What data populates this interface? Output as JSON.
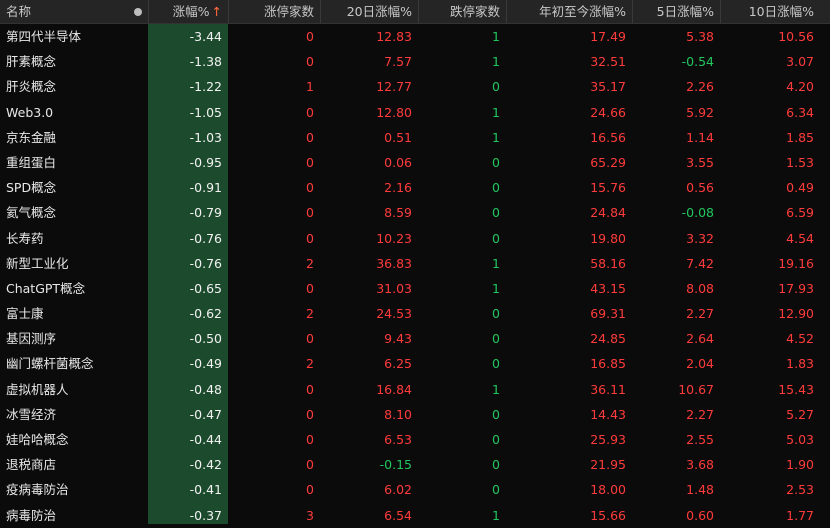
{
  "header": {
    "name": "名称",
    "change_pct": "涨幅%",
    "sort_arrow": "↑",
    "limit_up_count": "涨停家数",
    "change_20d": "20日涨幅%",
    "limit_down_count": "跌停家数",
    "ytd_change": "年初至今涨幅%",
    "change_5d": "5日涨幅%",
    "change_10d": "10日涨幅%"
  },
  "colors": {
    "up": "#ff3b3b",
    "down": "#22c55e",
    "highlight_column": "#1c4a2c",
    "background": "#0b0b0b"
  },
  "rows": [
    {
      "name": "第四代半导体",
      "change": "-3.44",
      "limit_up": "0",
      "c20": "12.83",
      "limit_down": "1",
      "ytd": "17.49",
      "c5": "5.38",
      "c10": "10.56"
    },
    {
      "name": "肝素概念",
      "change": "-1.38",
      "limit_up": "0",
      "c20": "7.57",
      "limit_down": "1",
      "ytd": "32.51",
      "c5": "-0.54",
      "c10": "3.07"
    },
    {
      "name": "肝炎概念",
      "change": "-1.22",
      "limit_up": "1",
      "c20": "12.77",
      "limit_down": "0",
      "ytd": "35.17",
      "c5": "2.26",
      "c10": "4.20"
    },
    {
      "name": "Web3.0",
      "change": "-1.05",
      "limit_up": "0",
      "c20": "12.80",
      "limit_down": "1",
      "ytd": "24.66",
      "c5": "5.92",
      "c10": "6.34"
    },
    {
      "name": "京东金融",
      "change": "-1.03",
      "limit_up": "0",
      "c20": "0.51",
      "limit_down": "1",
      "ytd": "16.56",
      "c5": "1.14",
      "c10": "1.85"
    },
    {
      "name": "重组蛋白",
      "change": "-0.95",
      "limit_up": "0",
      "c20": "0.06",
      "limit_down": "0",
      "ytd": "65.29",
      "c5": "3.55",
      "c10": "1.53"
    },
    {
      "name": "SPD概念",
      "change": "-0.91",
      "limit_up": "0",
      "c20": "2.16",
      "limit_down": "0",
      "ytd": "15.76",
      "c5": "0.56",
      "c10": "0.49"
    },
    {
      "name": "氦气概念",
      "change": "-0.79",
      "limit_up": "0",
      "c20": "8.59",
      "limit_down": "0",
      "ytd": "24.84",
      "c5": "-0.08",
      "c10": "6.59"
    },
    {
      "name": "长寿药",
      "change": "-0.76",
      "limit_up": "0",
      "c20": "10.23",
      "limit_down": "0",
      "ytd": "19.80",
      "c5": "3.32",
      "c10": "4.54"
    },
    {
      "name": "新型工业化",
      "change": "-0.76",
      "limit_up": "2",
      "c20": "36.83",
      "limit_down": "1",
      "ytd": "58.16",
      "c5": "7.42",
      "c10": "19.16"
    },
    {
      "name": "ChatGPT概念",
      "change": "-0.65",
      "limit_up": "0",
      "c20": "31.03",
      "limit_down": "1",
      "ytd": "43.15",
      "c5": "8.08",
      "c10": "17.93"
    },
    {
      "name": "富士康",
      "change": "-0.62",
      "limit_up": "2",
      "c20": "24.53",
      "limit_down": "0",
      "ytd": "69.31",
      "c5": "2.27",
      "c10": "12.90"
    },
    {
      "name": "基因测序",
      "change": "-0.50",
      "limit_up": "0",
      "c20": "9.43",
      "limit_down": "0",
      "ytd": "24.85",
      "c5": "2.64",
      "c10": "4.52"
    },
    {
      "name": "幽门螺杆菌概念",
      "change": "-0.49",
      "limit_up": "2",
      "c20": "6.25",
      "limit_down": "0",
      "ytd": "16.85",
      "c5": "2.04",
      "c10": "1.83"
    },
    {
      "name": "虚拟机器人",
      "change": "-0.48",
      "limit_up": "0",
      "c20": "16.84",
      "limit_down": "1",
      "ytd": "36.11",
      "c5": "10.67",
      "c10": "15.43"
    },
    {
      "name": "冰雪经济",
      "change": "-0.47",
      "limit_up": "0",
      "c20": "8.10",
      "limit_down": "0",
      "ytd": "14.43",
      "c5": "2.27",
      "c10": "5.27"
    },
    {
      "name": "娃哈哈概念",
      "change": "-0.44",
      "limit_up": "0",
      "c20": "6.53",
      "limit_down": "0",
      "ytd": "25.93",
      "c5": "2.55",
      "c10": "5.03"
    },
    {
      "name": "退税商店",
      "change": "-0.42",
      "limit_up": "0",
      "c20": "-0.15",
      "limit_down": "0",
      "ytd": "21.95",
      "c5": "3.68",
      "c10": "1.90"
    },
    {
      "name": "疫病毒防治",
      "change": "-0.41",
      "limit_up": "0",
      "c20": "6.02",
      "limit_down": "0",
      "ytd": "18.00",
      "c5": "1.48",
      "c10": "2.53"
    },
    {
      "name": "病毒防治",
      "change": "-0.37",
      "limit_up": "3",
      "c20": "6.54",
      "limit_down": "1",
      "ytd": "15.66",
      "c5": "0.60",
      "c10": "1.77"
    }
  ]
}
